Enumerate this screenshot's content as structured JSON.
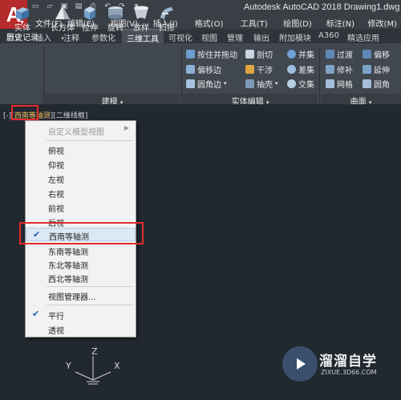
{
  "app": {
    "logo_letter": "A",
    "title": "Autodesk AutoCAD 2018    Drawing1.dwg"
  },
  "menubar": [
    "文件(F)",
    "编辑(E)",
    "视图(V)",
    "插入(I)",
    "格式(O)",
    "工具(T)",
    "绘图(D)",
    "标注(N)",
    "修改(M)"
  ],
  "ribbon_tabs": [
    "默认",
    "插入",
    "注释",
    "参数化",
    "三维工具",
    "可视化",
    "视图",
    "管理",
    "输出",
    "附加模块",
    "A360",
    "精选应用"
  ],
  "active_tab": "三维工具",
  "ribbon": {
    "history_label_1": "实体",
    "history_label_2": "历史记录",
    "modeling_tools": [
      "长方体",
      "拉伸",
      "旋转",
      "放样",
      "扫掠"
    ],
    "modeling_panel": "建模",
    "solid_edit_col1": [
      "按住并拖动",
      "偏移边",
      "圆角边"
    ],
    "solid_edit_col2": [
      "剖切",
      "干涉",
      "抽壳"
    ],
    "solid_edit_col3": [
      "并集",
      "差集",
      "交集"
    ],
    "solid_edit_panel": "实体编辑",
    "surface_col1": [
      "过渡",
      "修补",
      "网格"
    ],
    "surface_col2": [
      "偏移",
      "延伸",
      "圆角"
    ],
    "surface_panel": "曲面"
  },
  "viewport": {
    "label_pre": "[-][",
    "view_name": "西南等轴测",
    "label_post": "][二维线框]"
  },
  "context_menu": {
    "custom_views": "自定义模型视图",
    "items": [
      "俯视",
      "仰视",
      "左视",
      "右视",
      "前视",
      "后视",
      "西南等轴测",
      "东南等轴测",
      "东北等轴测",
      "西北等轴测"
    ],
    "selected": "西南等轴测",
    "view_manager": "视图管理器...",
    "parallel": "平行",
    "perspective": "透视"
  },
  "ucs": {
    "x": "X",
    "y": "Y",
    "z": "Z"
  },
  "watermark": {
    "name": "溜溜自学",
    "url": "ZIXUE.3D66.COM"
  },
  "colors": {
    "accent_red": "#e52b2b",
    "canvas": "#212830",
    "ribbon": "#41474f"
  }
}
